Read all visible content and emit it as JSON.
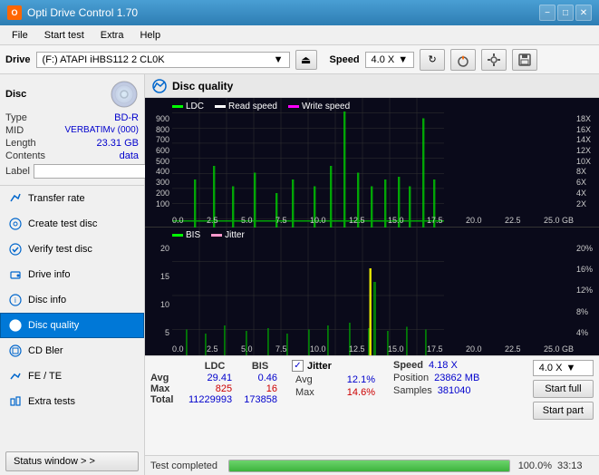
{
  "titlebar": {
    "title": "Opti Drive Control 1.70",
    "icon": "O",
    "minimize_label": "−",
    "maximize_label": "□",
    "close_label": "✕"
  },
  "menubar": {
    "items": [
      "File",
      "Start test",
      "Extra",
      "Help"
    ]
  },
  "drivebar": {
    "label": "Drive",
    "drive_value": "(F:)  ATAPI iHBS112  2 CL0K",
    "speed_label": "Speed",
    "speed_value": "4.0 X"
  },
  "sidebar": {
    "disc_section": {
      "title": "Disc",
      "fields": [
        {
          "label": "Type",
          "value": "BD-R"
        },
        {
          "label": "MID",
          "value": "VERBATIMv (000)"
        },
        {
          "label": "Length",
          "value": "23.31 GB"
        },
        {
          "label": "Contents",
          "value": "data"
        },
        {
          "label": "Label",
          "value": ""
        }
      ]
    },
    "nav_items": [
      {
        "id": "transfer-rate",
        "label": "Transfer rate",
        "active": false
      },
      {
        "id": "create-test-disc",
        "label": "Create test disc",
        "active": false
      },
      {
        "id": "verify-test-disc",
        "label": "Verify test disc",
        "active": false
      },
      {
        "id": "drive-info",
        "label": "Drive info",
        "active": false
      },
      {
        "id": "disc-info",
        "label": "Disc info",
        "active": false
      },
      {
        "id": "disc-quality",
        "label": "Disc quality",
        "active": true
      },
      {
        "id": "cd-bler",
        "label": "CD Bler",
        "active": false
      },
      {
        "id": "fe-te",
        "label": "FE / TE",
        "active": false
      },
      {
        "id": "extra-tests",
        "label": "Extra tests",
        "active": false
      }
    ],
    "status_window_btn": "Status window > >"
  },
  "disc_quality": {
    "title": "Disc quality",
    "chart_top": {
      "legend": [
        {
          "label": "LDC",
          "color": "#00ff00"
        },
        {
          "label": "Read speed",
          "color": "#ffffff"
        },
        {
          "label": "Write speed",
          "color": "#ff00ff"
        }
      ],
      "y_labels_left": [
        "900",
        "800",
        "700",
        "600",
        "500",
        "400",
        "300",
        "200",
        "100"
      ],
      "y_labels_right": [
        "18X",
        "16X",
        "14X",
        "12X",
        "10X",
        "8X",
        "6X",
        "4X",
        "2X"
      ],
      "x_labels": [
        "0.0",
        "2.5",
        "5.0",
        "7.5",
        "10.0",
        "12.5",
        "15.0",
        "17.5",
        "20.0",
        "22.5",
        "25.0 GB"
      ]
    },
    "chart_bottom": {
      "legend": [
        {
          "label": "BIS",
          "color": "#00ff00"
        },
        {
          "label": "Jitter",
          "color": "#ff99cc"
        }
      ],
      "y_labels_left": [
        "20",
        "15",
        "10",
        "5"
      ],
      "y_labels_right": [
        "20%",
        "16%",
        "12%",
        "8%",
        "4%"
      ],
      "x_labels": [
        "0.0",
        "2.5",
        "5.0",
        "7.5",
        "10.0",
        "12.5",
        "15.0",
        "17.5",
        "20.0",
        "22.5",
        "25.0 GB"
      ]
    }
  },
  "stats": {
    "columns": [
      "",
      "LDC",
      "BIS"
    ],
    "rows": [
      {
        "label": "Avg",
        "ldc": "29.41",
        "bis": "0.46"
      },
      {
        "label": "Max",
        "ldc": "825",
        "bis": "16"
      },
      {
        "label": "Total",
        "ldc": "11229993",
        "bis": "173858"
      }
    ],
    "jitter": {
      "checked": true,
      "label": "Jitter",
      "avg": "12.1%",
      "max": "14.6%"
    },
    "speed": {
      "label": "Speed",
      "value": "4.18 X",
      "position_label": "Position",
      "position_value": "23862 MB",
      "samples_label": "Samples",
      "samples_value": "381040",
      "dropdown_value": "4.0 X"
    },
    "buttons": {
      "start_full": "Start full",
      "start_part": "Start part"
    }
  },
  "progress": {
    "status": "Test completed",
    "percent": 100,
    "percent_label": "100.0%",
    "time": "33:13"
  }
}
